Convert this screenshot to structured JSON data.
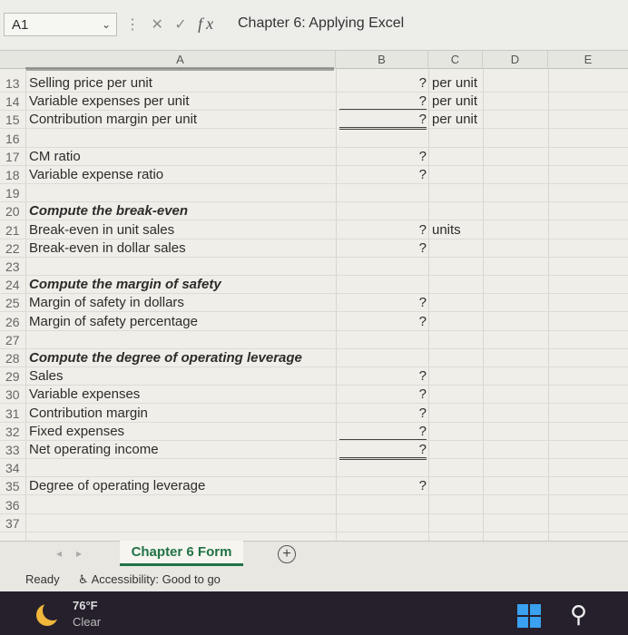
{
  "formula_bar": {
    "name_box": "A1",
    "name_box_dropdown": "⌄",
    "cancel_icon": "✕",
    "enter_icon": "✓",
    "fx_label": "fx",
    "formula": "Chapter 6: Applying Excel"
  },
  "columns": [
    "A",
    "B",
    "C",
    "D",
    "E"
  ],
  "rows": [
    {
      "num": "13",
      "label": "Selling price per unit",
      "b": "?",
      "c": "per unit"
    },
    {
      "num": "14",
      "label": "Variable expenses per unit",
      "b": "?",
      "c": "per unit"
    },
    {
      "num": "15",
      "label": "Contribution margin per unit",
      "b": "?",
      "c": "per unit"
    },
    {
      "num": "16",
      "label": "",
      "b": "",
      "c": ""
    },
    {
      "num": "17",
      "label": "CM ratio",
      "b": "?",
      "c": ""
    },
    {
      "num": "18",
      "label": "Variable expense ratio",
      "b": "?",
      "c": ""
    },
    {
      "num": "19",
      "label": "",
      "b": "",
      "c": ""
    },
    {
      "num": "20",
      "label": "Compute the break-even",
      "b": "",
      "c": ""
    },
    {
      "num": "21",
      "label": "Break-even in unit sales",
      "b": "?",
      "c": "units"
    },
    {
      "num": "22",
      "label": "Break-even in dollar sales",
      "b": "?",
      "c": ""
    },
    {
      "num": "23",
      "label": "",
      "b": "",
      "c": ""
    },
    {
      "num": "24",
      "label": "Compute the margin of safety",
      "b": "",
      "c": ""
    },
    {
      "num": "25",
      "label": "Margin of safety in dollars",
      "b": "?",
      "c": ""
    },
    {
      "num": "26",
      "label": "Margin of safety percentage",
      "b": "?",
      "c": ""
    },
    {
      "num": "27",
      "label": "",
      "b": "",
      "c": ""
    },
    {
      "num": "28",
      "label": "Compute the degree of operating leverage",
      "b": "",
      "c": ""
    },
    {
      "num": "29",
      "label": "Sales",
      "b": "?",
      "c": ""
    },
    {
      "num": "30",
      "label": "Variable expenses",
      "b": "?",
      "c": ""
    },
    {
      "num": "31",
      "label": "Contribution margin",
      "b": "?",
      "c": ""
    },
    {
      "num": "32",
      "label": "Fixed expenses",
      "b": "?",
      "c": ""
    },
    {
      "num": "33",
      "label": "Net operating income",
      "b": "?",
      "c": ""
    },
    {
      "num": "34",
      "label": "",
      "b": "",
      "c": ""
    },
    {
      "num": "35",
      "label": "Degree of operating leverage",
      "b": "?",
      "c": ""
    },
    {
      "num": "36",
      "label": "",
      "b": "",
      "c": ""
    },
    {
      "num": "37",
      "label": "",
      "b": "",
      "c": ""
    }
  ],
  "sheet_tabs": {
    "active": "Chapter 6 Form",
    "add_label": "+"
  },
  "status_bar": {
    "ready": "Ready",
    "accessibility": "Accessibility: Good to go"
  },
  "taskbar": {
    "temperature": "76°F",
    "weather": "Clear"
  }
}
